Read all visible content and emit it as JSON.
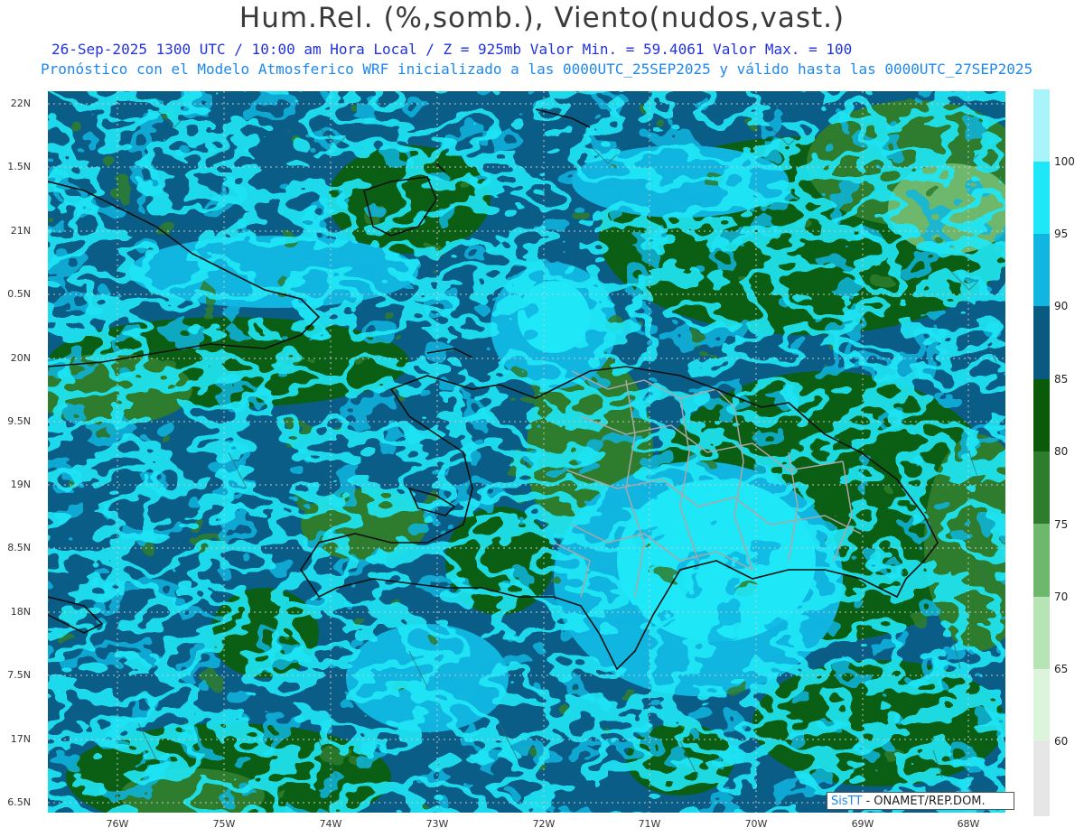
{
  "title": "Hum.Rel. (%,somb.), Viento(nudos,vast.)",
  "subtitle_line1": "26-Sep-2025  1300 UTC / 10:00 am Hora Local / Z = 925mb     Valor Min. = 59.4061  Valor Max. = 100",
  "subtitle_line2": "Pronóstico con el Modelo Atmosferico WRF inicializado a las 0000UTC_25SEP2025 y válido hasta las  0000UTC_27SEP2025",
  "lat_labels": [
    "22N",
    "1.5N",
    "21N",
    "0.5N",
    "20N",
    "9.5N",
    "19N",
    "8.5N",
    "18N",
    "7.5N",
    "17N",
    "6.5N"
  ],
  "lon_labels": [
    "76W",
    "75W",
    "74W",
    "73W",
    "72W",
    "71W",
    "70W",
    "69W",
    "68W"
  ],
  "colorbar": {
    "labels": [
      "100",
      "95",
      "90",
      "85",
      "80",
      "75",
      "70",
      "65",
      "60"
    ],
    "colors": [
      "#a8f4fa",
      "#1ee8f7",
      "#10b5e0",
      "#085a80",
      "#0a5a0a",
      "#2e7c2e",
      "#6eb86e",
      "#b6e4b4",
      "#dcf4dc",
      "#e6e6e6"
    ]
  },
  "credit": {
    "brand": "SisTT",
    "org": "- ONAMET/REP.DOM."
  },
  "palette": {
    "bg_ocean": "#0a5d86",
    "grid": "#c8c8c8",
    "coast": "#111111",
    "provinces": "#a0a0a0"
  }
}
